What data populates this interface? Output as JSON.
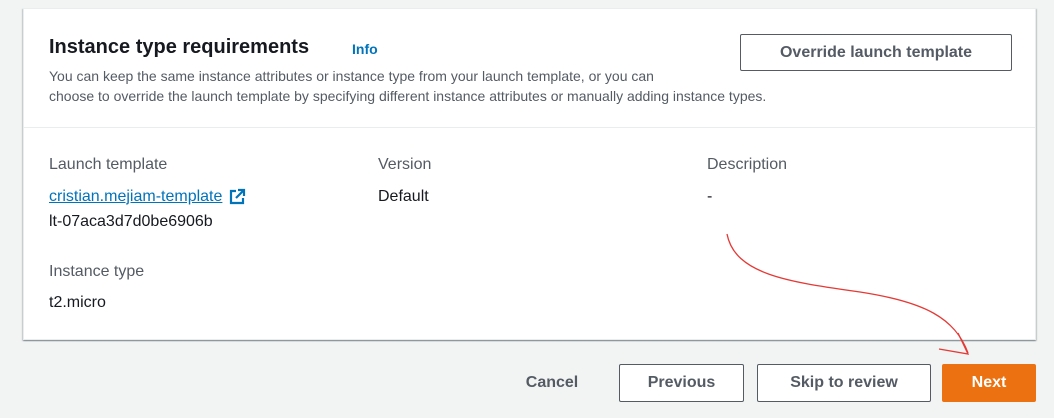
{
  "panel": {
    "title": "Instance type requirements",
    "info_label": "Info",
    "description_line1": "You can keep the same instance attributes or instance type from your launch template, or you can",
    "description_line2": "choose to override the launch template by specifying different instance attributes or manually adding instance types.",
    "override_button": "Override launch template"
  },
  "fields": {
    "launch_template_label": "Launch template",
    "launch_template_name": "cristian.mejiam-template",
    "launch_template_id": "lt-07aca3d7d0be6906b",
    "version_label": "Version",
    "version_value": "Default",
    "description_label": "Description",
    "description_value": "-",
    "instance_type_label": "Instance type",
    "instance_type_value": "t2.micro"
  },
  "footer": {
    "cancel": "Cancel",
    "previous": "Previous",
    "skip": "Skip to review",
    "next": "Next"
  },
  "colors": {
    "link": "#0073bb",
    "primary": "#ec7211",
    "annotation_arrow": "#e53935"
  }
}
